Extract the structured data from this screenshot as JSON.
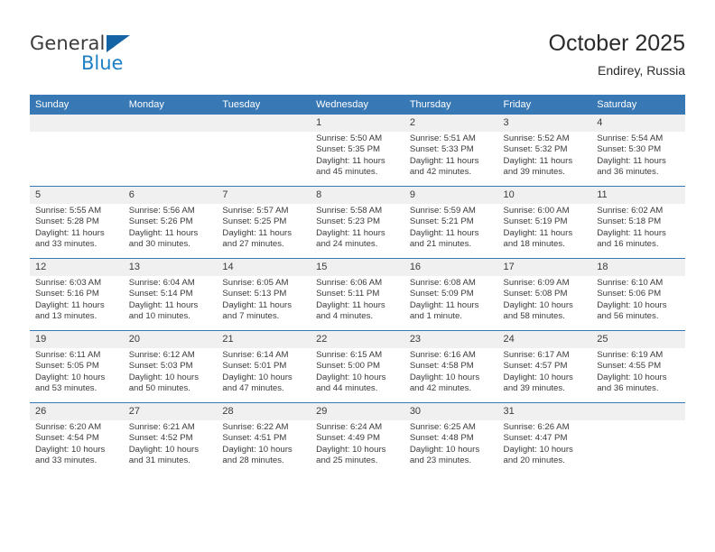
{
  "brand": {
    "name_top": "General",
    "name_bottom": "Blue",
    "color_blue": "#1f7fc4",
    "color_dark": "#3b3b3b"
  },
  "header": {
    "title": "October 2025",
    "subtitle": "Endirey, Russia"
  },
  "theme": {
    "header_blue": "#3778b5",
    "daynum_band": "#f0f0f0",
    "text": "#3b3b3b"
  },
  "weekday_headers": [
    "Sunday",
    "Monday",
    "Tuesday",
    "Wednesday",
    "Thursday",
    "Friday",
    "Saturday"
  ],
  "weeks": [
    [
      {
        "day": "",
        "sunrise": "",
        "sunset": "",
        "daylight": "",
        "empty": true
      },
      {
        "day": "",
        "sunrise": "",
        "sunset": "",
        "daylight": "",
        "empty": true
      },
      {
        "day": "",
        "sunrise": "",
        "sunset": "",
        "daylight": "",
        "empty": true
      },
      {
        "day": "1",
        "sunrise": "Sunrise: 5:50 AM",
        "sunset": "Sunset: 5:35 PM",
        "daylight": "Daylight: 11 hours and 45 minutes."
      },
      {
        "day": "2",
        "sunrise": "Sunrise: 5:51 AM",
        "sunset": "Sunset: 5:33 PM",
        "daylight": "Daylight: 11 hours and 42 minutes."
      },
      {
        "day": "3",
        "sunrise": "Sunrise: 5:52 AM",
        "sunset": "Sunset: 5:32 PM",
        "daylight": "Daylight: 11 hours and 39 minutes."
      },
      {
        "day": "4",
        "sunrise": "Sunrise: 5:54 AM",
        "sunset": "Sunset: 5:30 PM",
        "daylight": "Daylight: 11 hours and 36 minutes."
      }
    ],
    [
      {
        "day": "5",
        "sunrise": "Sunrise: 5:55 AM",
        "sunset": "Sunset: 5:28 PM",
        "daylight": "Daylight: 11 hours and 33 minutes."
      },
      {
        "day": "6",
        "sunrise": "Sunrise: 5:56 AM",
        "sunset": "Sunset: 5:26 PM",
        "daylight": "Daylight: 11 hours and 30 minutes."
      },
      {
        "day": "7",
        "sunrise": "Sunrise: 5:57 AM",
        "sunset": "Sunset: 5:25 PM",
        "daylight": "Daylight: 11 hours and 27 minutes."
      },
      {
        "day": "8",
        "sunrise": "Sunrise: 5:58 AM",
        "sunset": "Sunset: 5:23 PM",
        "daylight": "Daylight: 11 hours and 24 minutes."
      },
      {
        "day": "9",
        "sunrise": "Sunrise: 5:59 AM",
        "sunset": "Sunset: 5:21 PM",
        "daylight": "Daylight: 11 hours and 21 minutes."
      },
      {
        "day": "10",
        "sunrise": "Sunrise: 6:00 AM",
        "sunset": "Sunset: 5:19 PM",
        "daylight": "Daylight: 11 hours and 18 minutes."
      },
      {
        "day": "11",
        "sunrise": "Sunrise: 6:02 AM",
        "sunset": "Sunset: 5:18 PM",
        "daylight": "Daylight: 11 hours and 16 minutes."
      }
    ],
    [
      {
        "day": "12",
        "sunrise": "Sunrise: 6:03 AM",
        "sunset": "Sunset: 5:16 PM",
        "daylight": "Daylight: 11 hours and 13 minutes."
      },
      {
        "day": "13",
        "sunrise": "Sunrise: 6:04 AM",
        "sunset": "Sunset: 5:14 PM",
        "daylight": "Daylight: 11 hours and 10 minutes."
      },
      {
        "day": "14",
        "sunrise": "Sunrise: 6:05 AM",
        "sunset": "Sunset: 5:13 PM",
        "daylight": "Daylight: 11 hours and 7 minutes."
      },
      {
        "day": "15",
        "sunrise": "Sunrise: 6:06 AM",
        "sunset": "Sunset: 5:11 PM",
        "daylight": "Daylight: 11 hours and 4 minutes."
      },
      {
        "day": "16",
        "sunrise": "Sunrise: 6:08 AM",
        "sunset": "Sunset: 5:09 PM",
        "daylight": "Daylight: 11 hours and 1 minute."
      },
      {
        "day": "17",
        "sunrise": "Sunrise: 6:09 AM",
        "sunset": "Sunset: 5:08 PM",
        "daylight": "Daylight: 10 hours and 58 minutes."
      },
      {
        "day": "18",
        "sunrise": "Sunrise: 6:10 AM",
        "sunset": "Sunset: 5:06 PM",
        "daylight": "Daylight: 10 hours and 56 minutes."
      }
    ],
    [
      {
        "day": "19",
        "sunrise": "Sunrise: 6:11 AM",
        "sunset": "Sunset: 5:05 PM",
        "daylight": "Daylight: 10 hours and 53 minutes."
      },
      {
        "day": "20",
        "sunrise": "Sunrise: 6:12 AM",
        "sunset": "Sunset: 5:03 PM",
        "daylight": "Daylight: 10 hours and 50 minutes."
      },
      {
        "day": "21",
        "sunrise": "Sunrise: 6:14 AM",
        "sunset": "Sunset: 5:01 PM",
        "daylight": "Daylight: 10 hours and 47 minutes."
      },
      {
        "day": "22",
        "sunrise": "Sunrise: 6:15 AM",
        "sunset": "Sunset: 5:00 PM",
        "daylight": "Daylight: 10 hours and 44 minutes."
      },
      {
        "day": "23",
        "sunrise": "Sunrise: 6:16 AM",
        "sunset": "Sunset: 4:58 PM",
        "daylight": "Daylight: 10 hours and 42 minutes."
      },
      {
        "day": "24",
        "sunrise": "Sunrise: 6:17 AM",
        "sunset": "Sunset: 4:57 PM",
        "daylight": "Daylight: 10 hours and 39 minutes."
      },
      {
        "day": "25",
        "sunrise": "Sunrise: 6:19 AM",
        "sunset": "Sunset: 4:55 PM",
        "daylight": "Daylight: 10 hours and 36 minutes."
      }
    ],
    [
      {
        "day": "26",
        "sunrise": "Sunrise: 6:20 AM",
        "sunset": "Sunset: 4:54 PM",
        "daylight": "Daylight: 10 hours and 33 minutes."
      },
      {
        "day": "27",
        "sunrise": "Sunrise: 6:21 AM",
        "sunset": "Sunset: 4:52 PM",
        "daylight": "Daylight: 10 hours and 31 minutes."
      },
      {
        "day": "28",
        "sunrise": "Sunrise: 6:22 AM",
        "sunset": "Sunset: 4:51 PM",
        "daylight": "Daylight: 10 hours and 28 minutes."
      },
      {
        "day": "29",
        "sunrise": "Sunrise: 6:24 AM",
        "sunset": "Sunset: 4:49 PM",
        "daylight": "Daylight: 10 hours and 25 minutes."
      },
      {
        "day": "30",
        "sunrise": "Sunrise: 6:25 AM",
        "sunset": "Sunset: 4:48 PM",
        "daylight": "Daylight: 10 hours and 23 minutes."
      },
      {
        "day": "31",
        "sunrise": "Sunrise: 6:26 AM",
        "sunset": "Sunset: 4:47 PM",
        "daylight": "Daylight: 10 hours and 20 minutes."
      },
      {
        "day": "",
        "sunrise": "",
        "sunset": "",
        "daylight": "",
        "empty": true
      }
    ]
  ]
}
